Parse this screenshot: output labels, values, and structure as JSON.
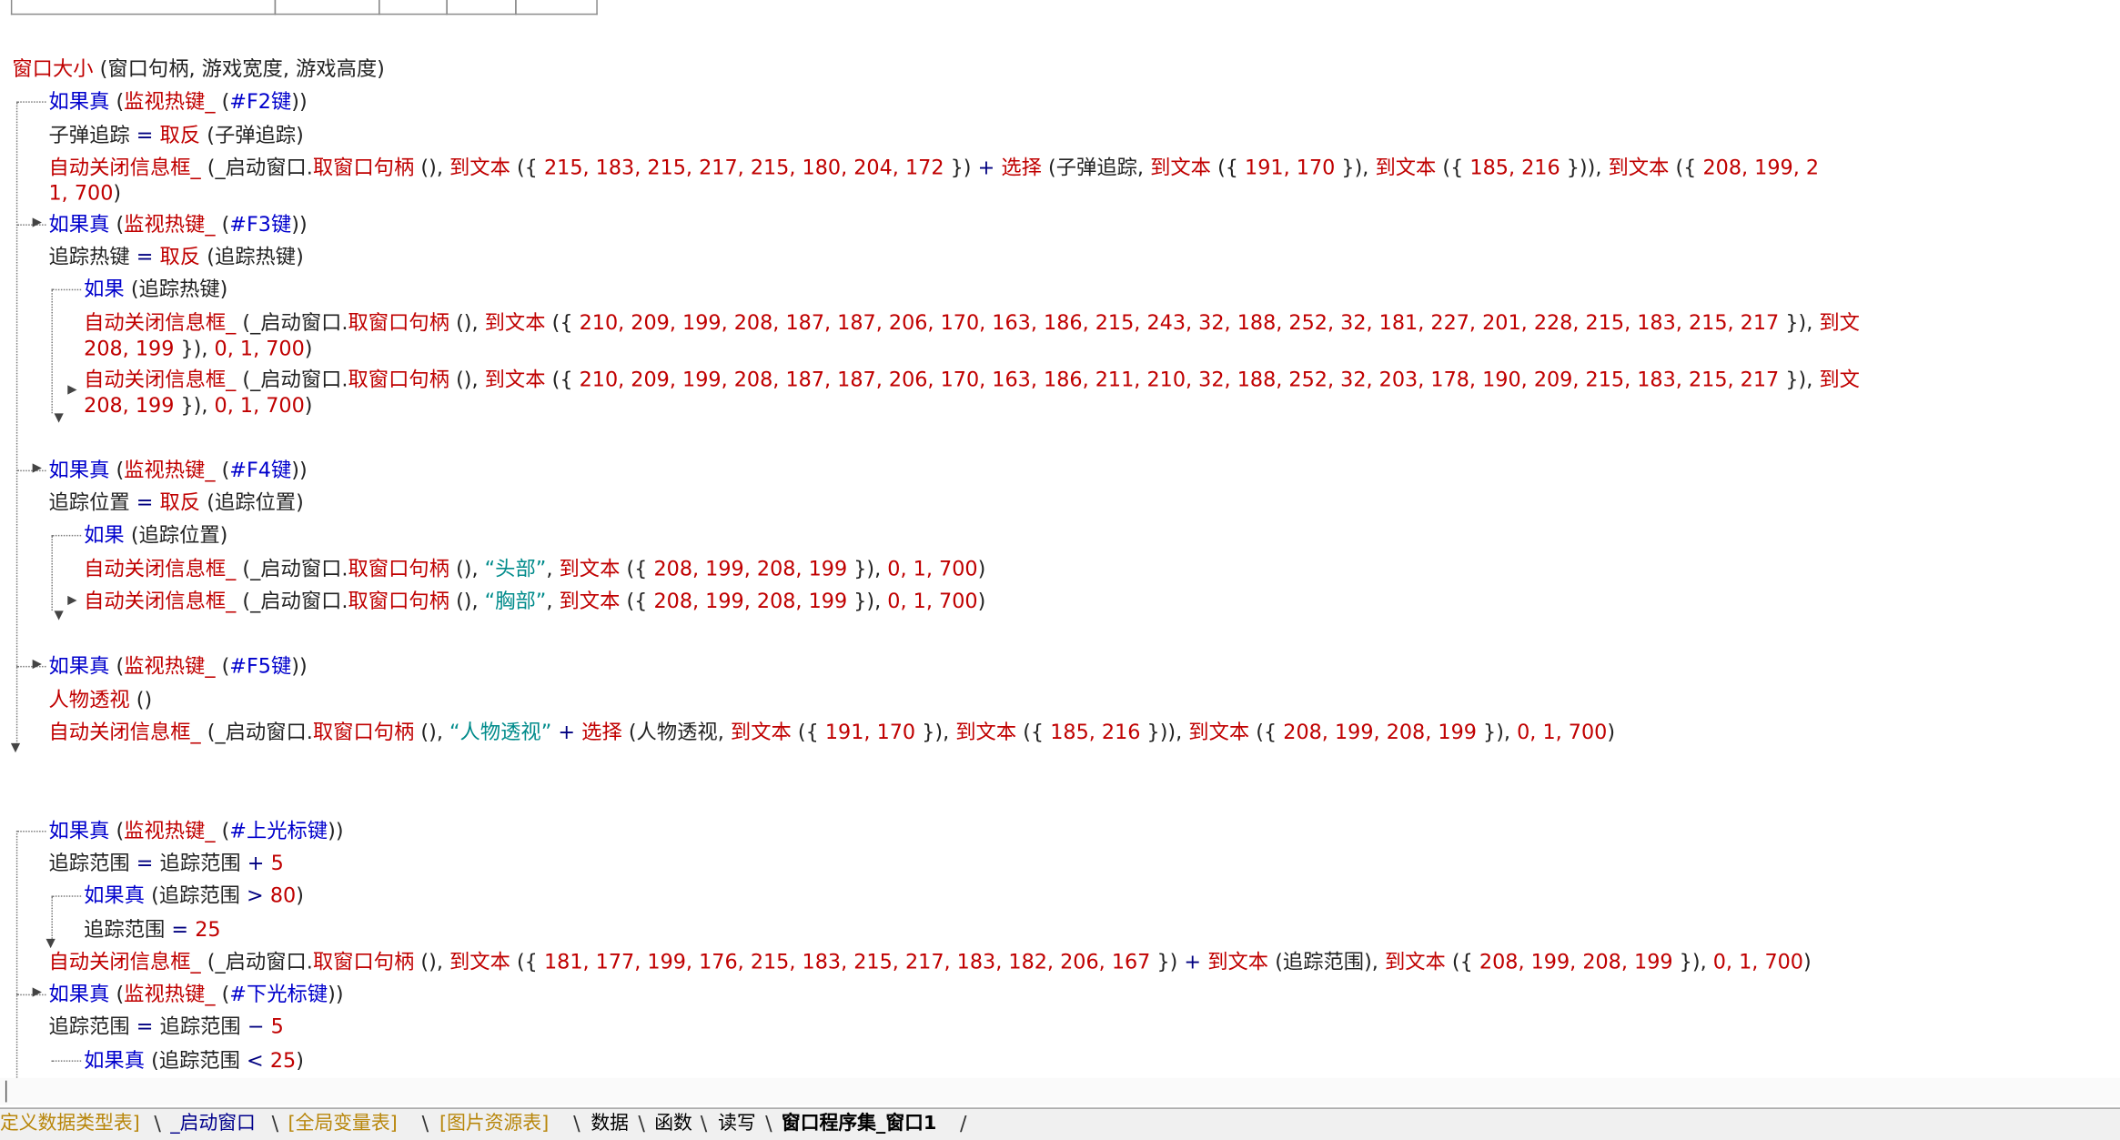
{
  "lines": [
    [
      [
        "f",
        "窗口大小"
      ],
      [
        "n",
        " (窗口句柄, 游戏宽度, 游戏高度)"
      ]
    ],
    [
      [
        "k",
        "如果真"
      ],
      [
        "n",
        " ("
      ],
      [
        "f",
        "监视热键_"
      ],
      [
        "n",
        " ("
      ],
      [
        "k",
        "#F2键"
      ],
      [
        "n",
        "))"
      ]
    ],
    [
      [
        "n",
        "子弹追踪 "
      ],
      [
        "op",
        "="
      ],
      [
        "n",
        " "
      ],
      [
        "f",
        "取反"
      ],
      [
        "n",
        " (子弹追踪)"
      ]
    ],
    [
      [
        "f",
        "自动关闭信息框_"
      ],
      [
        "n",
        " (_启动窗口."
      ],
      [
        "f",
        "取窗口句柄"
      ],
      [
        "n",
        " (), "
      ],
      [
        "f",
        "到文本"
      ],
      [
        "n",
        " ({ "
      ],
      [
        "f",
        "215, 183, 215, 217, 215, 180, 204, 172"
      ],
      [
        "n",
        " }) "
      ],
      [
        "op",
        "+"
      ],
      [
        "n",
        " "
      ],
      [
        "f",
        "选择"
      ],
      [
        "n",
        " (子弹追踪, "
      ],
      [
        "f",
        "到文本"
      ],
      [
        "n",
        " ({ "
      ],
      [
        "f",
        "191, 170"
      ],
      [
        "n",
        " }), "
      ],
      [
        "f",
        "到文本"
      ],
      [
        "n",
        " ({ "
      ],
      [
        "f",
        "185, 216"
      ],
      [
        "n",
        " })), "
      ],
      [
        "f",
        "到文本"
      ],
      [
        "n",
        " ({ "
      ],
      [
        "f",
        "208, 199, 2"
      ]
    ],
    [
      [
        "f",
        "1, 700"
      ],
      [
        "n",
        ")"
      ]
    ],
    [
      [
        "k",
        "如果真"
      ],
      [
        "n",
        " ("
      ],
      [
        "f",
        "监视热键_"
      ],
      [
        "n",
        " ("
      ],
      [
        "k",
        "#F3键"
      ],
      [
        "n",
        "))"
      ]
    ],
    [
      [
        "n",
        "追踪热键 "
      ],
      [
        "op",
        "="
      ],
      [
        "n",
        " "
      ],
      [
        "f",
        "取反"
      ],
      [
        "n",
        " (追踪热键)"
      ]
    ],
    [
      [
        "k",
        "如果"
      ],
      [
        "n",
        " (追踪热键)"
      ]
    ],
    [
      [
        "f",
        "自动关闭信息框_"
      ],
      [
        "n",
        " (_启动窗口."
      ],
      [
        "f",
        "取窗口句柄"
      ],
      [
        "n",
        " (), "
      ],
      [
        "f",
        "到文本"
      ],
      [
        "n",
        " ({ "
      ],
      [
        "f",
        "210, 209, 199, 208, 187, 187, 206, 170, 163, 186, 215, 243, 32, 188, 252, 32, 181, 227, 201, 228, 215, 183, 215, 217"
      ],
      [
        "n",
        " }), "
      ],
      [
        "f",
        "到文"
      ]
    ],
    [
      [
        "f",
        "208, 199"
      ],
      [
        "n",
        " }), "
      ],
      [
        "f",
        "0, 1, 700"
      ],
      [
        "n",
        ")"
      ]
    ],
    [
      [
        "f",
        "自动关闭信息框_"
      ],
      [
        "n",
        " (_启动窗口."
      ],
      [
        "f",
        "取窗口句柄"
      ],
      [
        "n",
        " (), "
      ],
      [
        "f",
        "到文本"
      ],
      [
        "n",
        " ({ "
      ],
      [
        "f",
        "210, 209, 199, 208, 187, 187, 206, 170, 163, 186, 211, 210, 32, 188, 252, 32, 203, 178, 190, 209, 215, 183, 215, 217"
      ],
      [
        "n",
        " }), "
      ],
      [
        "f",
        "到文"
      ]
    ],
    [
      [
        "f",
        "208, 199"
      ],
      [
        "n",
        " }), "
      ],
      [
        "f",
        "0, 1, 700"
      ],
      [
        "n",
        ")"
      ]
    ],
    [
      [
        "k",
        "如果真"
      ],
      [
        "n",
        " ("
      ],
      [
        "f",
        "监视热键_"
      ],
      [
        "n",
        " ("
      ],
      [
        "k",
        "#F4键"
      ],
      [
        "n",
        "))"
      ]
    ],
    [
      [
        "n",
        "追踪位置 "
      ],
      [
        "op",
        "="
      ],
      [
        "n",
        " "
      ],
      [
        "f",
        "取反"
      ],
      [
        "n",
        " (追踪位置)"
      ]
    ],
    [
      [
        "k",
        "如果"
      ],
      [
        "n",
        " (追踪位置)"
      ]
    ],
    [
      [
        "f",
        "自动关闭信息框_"
      ],
      [
        "n",
        " (_启动窗口."
      ],
      [
        "f",
        "取窗口句柄"
      ],
      [
        "n",
        " (), "
      ],
      [
        "s",
        "“头部”"
      ],
      [
        "n",
        ", "
      ],
      [
        "f",
        "到文本"
      ],
      [
        "n",
        " ({ "
      ],
      [
        "f",
        "208, 199, 208, 199"
      ],
      [
        "n",
        " }), "
      ],
      [
        "f",
        "0, 1, 700"
      ],
      [
        "n",
        ")"
      ]
    ],
    [
      [
        "f",
        "自动关闭信息框_"
      ],
      [
        "n",
        " (_启动窗口."
      ],
      [
        "f",
        "取窗口句柄"
      ],
      [
        "n",
        " (), "
      ],
      [
        "s",
        "“胸部”"
      ],
      [
        "n",
        ", "
      ],
      [
        "f",
        "到文本"
      ],
      [
        "n",
        " ({ "
      ],
      [
        "f",
        "208, 199, 208, 199"
      ],
      [
        "n",
        " }), "
      ],
      [
        "f",
        "0, 1, 700"
      ],
      [
        "n",
        ")"
      ]
    ],
    [
      [
        "k",
        "如果真"
      ],
      [
        "n",
        " ("
      ],
      [
        "f",
        "监视热键_"
      ],
      [
        "n",
        " ("
      ],
      [
        "k",
        "#F5键"
      ],
      [
        "n",
        "))"
      ]
    ],
    [
      [
        "f",
        "人物透视"
      ],
      [
        "n",
        " ()"
      ]
    ],
    [
      [
        "f",
        "自动关闭信息框_"
      ],
      [
        "n",
        " (_启动窗口."
      ],
      [
        "f",
        "取窗口句柄"
      ],
      [
        "n",
        " (), "
      ],
      [
        "s",
        "“人物透视”"
      ],
      [
        "n",
        " "
      ],
      [
        "op",
        "+"
      ],
      [
        "n",
        " "
      ],
      [
        "f",
        "选择"
      ],
      [
        "n",
        " (人物透视, "
      ],
      [
        "f",
        "到文本"
      ],
      [
        "n",
        " ({ "
      ],
      [
        "f",
        "191, 170"
      ],
      [
        "n",
        " }), "
      ],
      [
        "f",
        "到文本"
      ],
      [
        "n",
        " ({ "
      ],
      [
        "f",
        "185, 216"
      ],
      [
        "n",
        " })), "
      ],
      [
        "f",
        "到文本"
      ],
      [
        "n",
        " ({ "
      ],
      [
        "f",
        "208, 199, 208, 199"
      ],
      [
        "n",
        " }), "
      ],
      [
        "f",
        "0, 1, 700"
      ],
      [
        "n",
        ")"
      ]
    ],
    [
      [
        "k",
        "如果真"
      ],
      [
        "n",
        " ("
      ],
      [
        "f",
        "监视热键_"
      ],
      [
        "n",
        " ("
      ],
      [
        "k",
        "#上光标键"
      ],
      [
        "n",
        "))"
      ]
    ],
    [
      [
        "n",
        "追踪范围 "
      ],
      [
        "op",
        "="
      ],
      [
        "n",
        " 追踪范围 "
      ],
      [
        "op",
        "+"
      ],
      [
        "n",
        " "
      ],
      [
        "f",
        "5"
      ]
    ],
    [
      [
        "k",
        "如果真"
      ],
      [
        "n",
        " (追踪范围 "
      ],
      [
        "op",
        ">"
      ],
      [
        "n",
        " "
      ],
      [
        "f",
        "80"
      ],
      [
        "n",
        ")"
      ]
    ],
    [
      [
        "n",
        "追踪范围 "
      ],
      [
        "op",
        "="
      ],
      [
        "n",
        " "
      ],
      [
        "f",
        "25"
      ]
    ],
    [
      [
        "f",
        "自动关闭信息框_"
      ],
      [
        "n",
        " (_启动窗口."
      ],
      [
        "f",
        "取窗口句柄"
      ],
      [
        "n",
        " (), "
      ],
      [
        "f",
        "到文本"
      ],
      [
        "n",
        " ({ "
      ],
      [
        "f",
        "181, 177, 199, 176, 215, 183, 215, 217, 183, 182, 206, 167"
      ],
      [
        "n",
        " }) "
      ],
      [
        "op",
        "+"
      ],
      [
        "n",
        " "
      ],
      [
        "f",
        "到文本"
      ],
      [
        "n",
        " (追踪范围), "
      ],
      [
        "f",
        "到文本"
      ],
      [
        "n",
        " ({ "
      ],
      [
        "f",
        "208, 199, 208, 199"
      ],
      [
        "n",
        " }), "
      ],
      [
        "f",
        "0, 1, 700"
      ],
      [
        "n",
        ")"
      ]
    ],
    [
      [
        "k",
        "如果真"
      ],
      [
        "n",
        " ("
      ],
      [
        "f",
        "监视热键_"
      ],
      [
        "n",
        " ("
      ],
      [
        "k",
        "#下光标键"
      ],
      [
        "n",
        "))"
      ]
    ],
    [
      [
        "n",
        "追踪范围 "
      ],
      [
        "op",
        "="
      ],
      [
        "n",
        " 追踪范围 "
      ],
      [
        "op",
        "−"
      ],
      [
        "n",
        " "
      ],
      [
        "f",
        "5"
      ]
    ],
    [
      [
        "k",
        "如果真"
      ],
      [
        "n",
        " (追踪范围 "
      ],
      [
        "op",
        "<"
      ],
      [
        "n",
        " "
      ],
      [
        "f",
        "25"
      ],
      [
        "n",
        ")"
      ]
    ]
  ],
  "tabs": {
    "t1": "定义数据类型表]",
    "t2": "_启动窗口",
    "t3": "[全局变量表]",
    "t4": "[图片资源表]",
    "t5": "数据",
    "t6": "函数",
    "t7": "读写",
    "t8": "窗口程序集_窗口1"
  }
}
